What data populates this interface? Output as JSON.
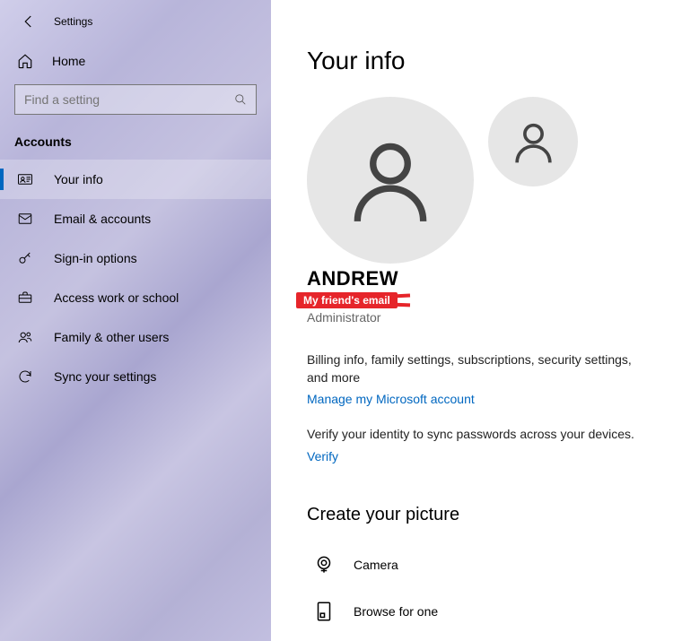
{
  "header": {
    "settings_label": "Settings",
    "home_label": "Home"
  },
  "search": {
    "placeholder": "Find a setting"
  },
  "section": {
    "title": "Accounts"
  },
  "nav": {
    "your_info": "Your info",
    "email_accounts": "Email & accounts",
    "signin_options": "Sign-in options",
    "access_work": "Access work or school",
    "family_users": "Family & other users",
    "sync_settings": "Sync your settings"
  },
  "main": {
    "title": "Your info",
    "user_name": "ANDREW",
    "redacted_email_label": "My friend's email",
    "role": "Administrator",
    "billing_text": "Billing info, family settings, subscriptions, security settings, and more",
    "manage_link": "Manage my Microsoft account",
    "verify_text": "Verify your identity to sync passwords across your devices.",
    "verify_link": "Verify",
    "picture_heading": "Create your picture",
    "camera_label": "Camera",
    "browse_label": "Browse for one"
  }
}
